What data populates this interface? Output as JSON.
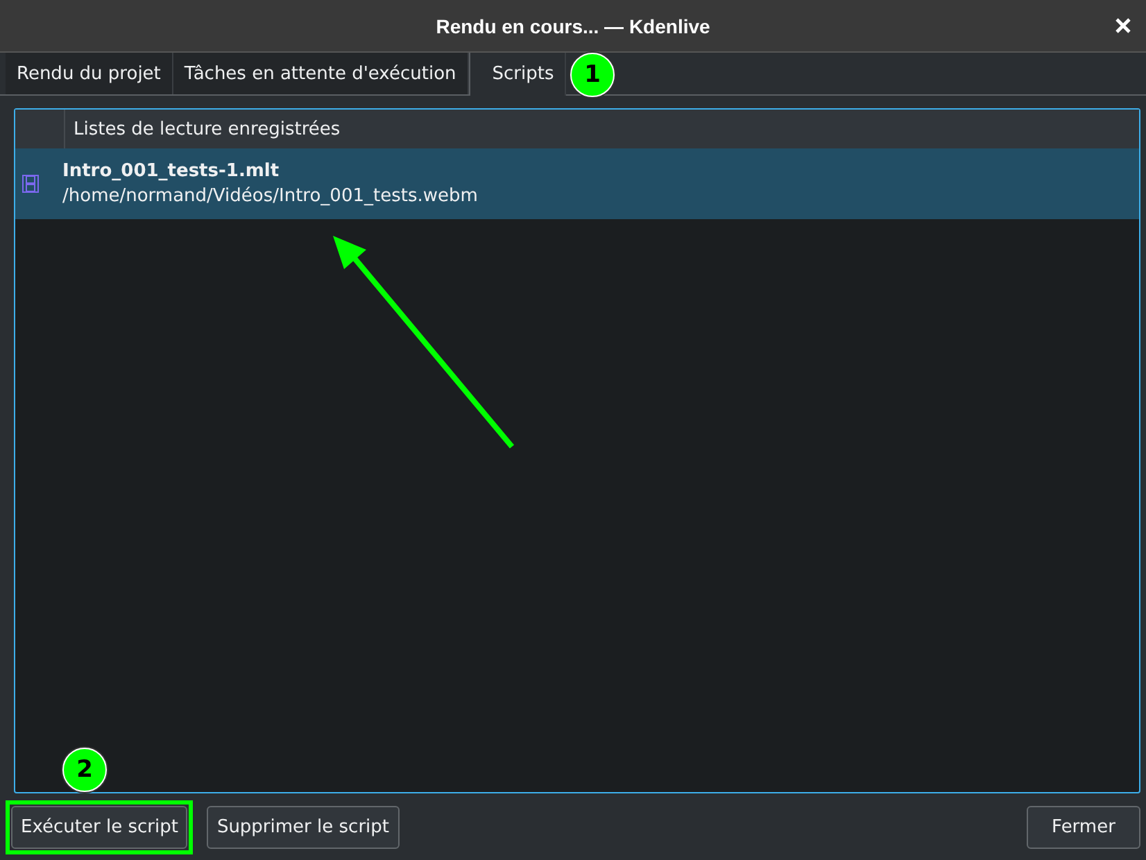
{
  "window": {
    "title": "Rendu en cours... — Kdenlive"
  },
  "tabs": [
    {
      "label": "Rendu du projet",
      "selected": false
    },
    {
      "label": "Tâches en attente d'exécution",
      "selected": false
    },
    {
      "label": "Scripts",
      "selected": true
    }
  ],
  "table": {
    "columns": [
      "Listes de lecture enregistrées"
    ],
    "rows": [
      {
        "name": "Intro_001_tests-1.mlt",
        "path": "/home/normand/Vidéos/Intro_001_tests.webm",
        "selected": true
      }
    ]
  },
  "buttons": [
    {
      "label": "Exécuter le script",
      "highlighted": true
    },
    {
      "label": "Supprimer le script",
      "highlighted": false
    }
  ],
  "close_button": {
    "label": "Fermer"
  },
  "callouts": [
    {
      "label": "1"
    },
    {
      "label": "2"
    }
  ]
}
